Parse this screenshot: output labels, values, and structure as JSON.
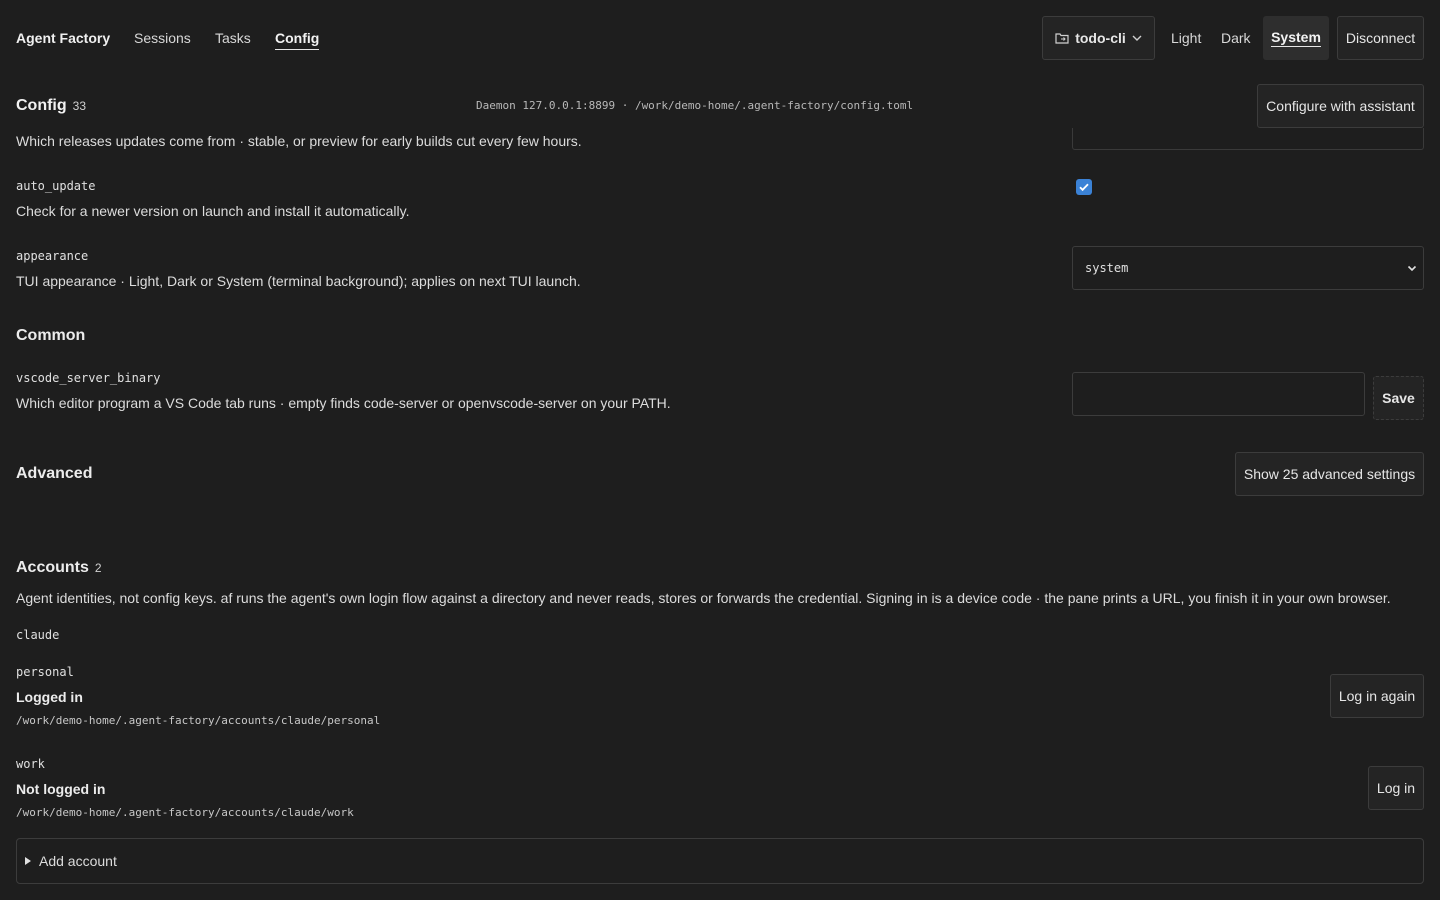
{
  "nav": {
    "brand": "Agent Factory",
    "links": [
      "Sessions",
      "Tasks",
      "Config"
    ],
    "project": "todo-cli",
    "themes": [
      "Light",
      "Dark",
      "System"
    ],
    "disconnect": "Disconnect"
  },
  "config": {
    "title": "Config",
    "count": "33",
    "daemon": "Daemon 127.0.0.1:8899 · /work/demo-home/.agent-factory/config.toml",
    "assistant_btn": "Configure with assistant"
  },
  "settings": {
    "channel_desc": "Which releases updates come from · stable, or preview for early builds cut every few hours.",
    "auto_update": {
      "key": "auto_update",
      "desc": "Check for a newer version on launch and install it automatically.",
      "checked": true
    },
    "appearance": {
      "key": "appearance",
      "desc": "TUI appearance · Light, Dark or System (terminal background); applies on next TUI launch.",
      "value": "system"
    },
    "common_title": "Common",
    "vscode": {
      "key": "vscode_server_binary",
      "desc": "Which editor program a VS Code tab runs · empty finds code-server or openvscode-server on your PATH.",
      "value": "",
      "save": "Save"
    },
    "advanced_title": "Advanced",
    "advanced_btn": "Show 25 advanced settings"
  },
  "accounts": {
    "title": "Accounts",
    "count": "2",
    "desc": "Agent identities, not config keys. af runs the agent's own login flow against a directory and never reads, stores or forwards the credential. Signing in is a device code · the pane prints a URL, you finish it in your own browser.",
    "agent": "claude",
    "items": [
      {
        "name": "personal",
        "status": "Logged in",
        "path": "/work/demo-home/.agent-factory/accounts/claude/personal",
        "action": "Log in again"
      },
      {
        "name": "work",
        "status": "Not logged in",
        "path": "/work/demo-home/.agent-factory/accounts/claude/work",
        "action": "Log in"
      }
    ],
    "add": "Add account"
  },
  "colors": {
    "accent": "#3b82d6",
    "background": "#1e1e1e"
  }
}
